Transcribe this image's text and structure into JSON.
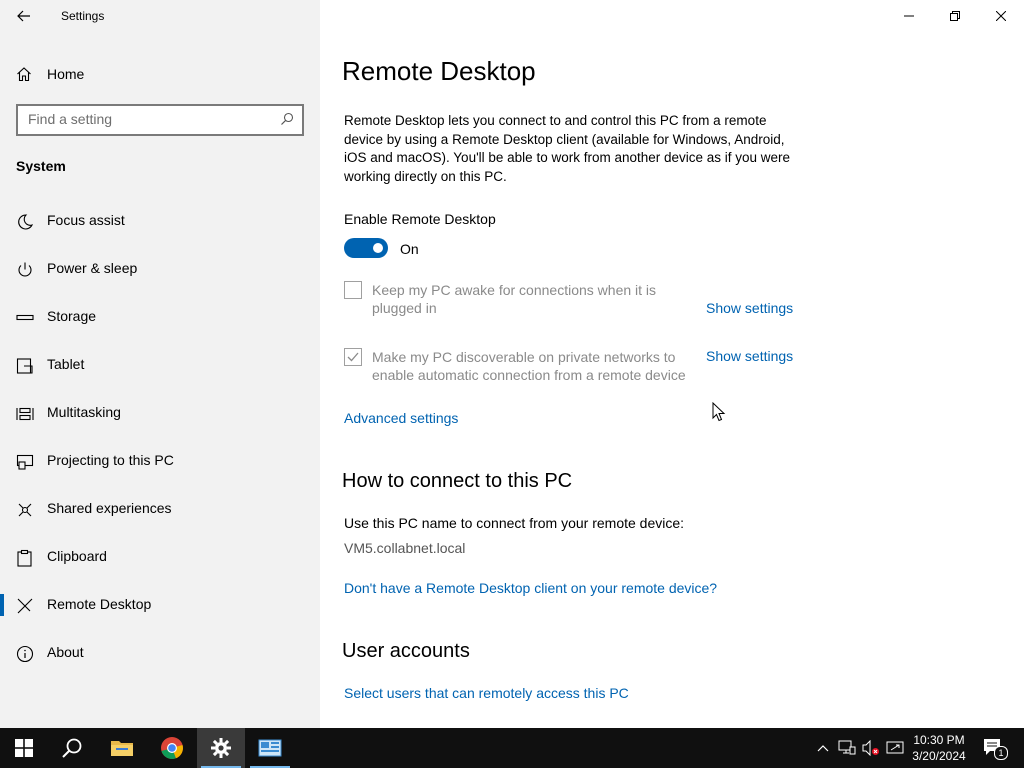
{
  "window": {
    "title": "Settings"
  },
  "sidebar": {
    "home_label": "Home",
    "search_placeholder": "Find a setting",
    "section_label": "System",
    "items": [
      {
        "label": "Focus assist",
        "icon": "moon-icon"
      },
      {
        "label": "Power & sleep",
        "icon": "power-icon"
      },
      {
        "label": "Storage",
        "icon": "storage-icon"
      },
      {
        "label": "Tablet",
        "icon": "tablet-icon"
      },
      {
        "label": "Multitasking",
        "icon": "multitasking-icon"
      },
      {
        "label": "Projecting to this PC",
        "icon": "projecting-icon"
      },
      {
        "label": "Shared experiences",
        "icon": "shared-experiences-icon"
      },
      {
        "label": "Clipboard",
        "icon": "clipboard-icon"
      },
      {
        "label": "Remote Desktop",
        "icon": "remote-desktop-icon",
        "active": true
      },
      {
        "label": "About",
        "icon": "info-icon"
      }
    ]
  },
  "main": {
    "title": "Remote Desktop",
    "description": "Remote Desktop lets you connect to and control this PC from a remote device by using a Remote Desktop client (available for Windows, Android, iOS and macOS). You'll be able to work from another device as if you were working directly on this PC.",
    "enable_label": "Enable Remote Desktop",
    "toggle_state": "On",
    "options": [
      {
        "text": "Keep my PC awake for connections when it is plugged in",
        "checked": false,
        "link": "Show settings"
      },
      {
        "text": "Make my PC discoverable on private networks to enable automatic connection from a remote device",
        "checked": true,
        "link": "Show settings"
      }
    ],
    "advanced_link": "Advanced settings",
    "connect_heading": "How to connect to this PC",
    "connect_text": "Use this PC name to connect from your remote device:",
    "pc_name": "VM5.collabnet.local",
    "client_link": "Don't have a Remote Desktop client on your remote device?",
    "accounts_heading": "User accounts",
    "accounts_link": "Select users that can remotely access this PC"
  },
  "taskbar": {
    "time": "10:30 PM",
    "date": "3/20/2024",
    "notification_count": "1",
    "accent": "#76b9ed"
  }
}
